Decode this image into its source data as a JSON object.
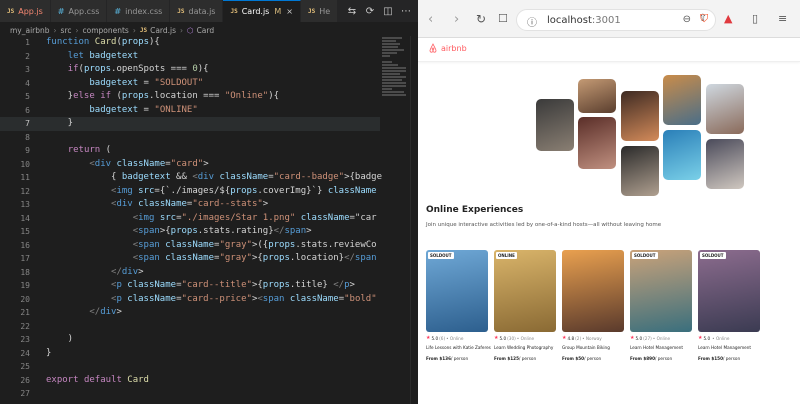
{
  "editor": {
    "tabs": [
      {
        "name": "App.js",
        "type": "js",
        "active": false,
        "color": "red"
      },
      {
        "name": "App.css",
        "type": "css",
        "active": false
      },
      {
        "name": "index.css",
        "type": "css",
        "active": false
      },
      {
        "name": "data.js",
        "type": "js",
        "active": false
      },
      {
        "name": "Card.js",
        "type": "js",
        "active": true,
        "modified": "M"
      },
      {
        "name": "He",
        "type": "js",
        "active": false
      }
    ],
    "breadcrumb": [
      "my_airbnb",
      "src",
      "components",
      "Card.js",
      "Card"
    ],
    "code": [
      "function Card(props){",
      "    let badgetext",
      "    if(props.openSpots === 0){",
      "        badgetext = \"SOLDOUT\"",
      "    }else if (props.location === \"Online\"){",
      "        badgetext = \"ONLINE\"",
      "    }",
      "",
      "    return (",
      "        <div className=\"card\">",
      "            { badgetext && <div className=\"card--badge\">{badge",
      "            <img src={`./images/${props.coverImg}`} className",
      "            <div className=\"card--stats\">",
      "                <img src=\"./images/Star 1.png\" className=\"car",
      "                <span>{props.stats.rating}</span>",
      "                <span className=\"gray\">({props.stats.reviewCo",
      "                <span className=\"gray\">{props.location}</span",
      "            </div>",
      "            <p className=\"card--title\">{props.title} </p>",
      "            <p className=\"card--price\"><span className=\"bold\"",
      "        </div>",
      "",
      "    )",
      "}",
      "",
      "export default Card",
      ""
    ]
  },
  "browser": {
    "url_host": "localhost",
    "url_port": ":3001",
    "logo_text": "airbnb",
    "section_title": "Online Experiences",
    "section_desc": "Join unique interactive activities led by one-of-a-kind hosts—all without leaving home",
    "cards": [
      {
        "badge": "SOLDOUT",
        "rating": "5.0",
        "reviews": "(6)",
        "location": "• Online",
        "title": "Life Lessons with Katie Zaferes",
        "price": "From $136",
        "per": "/ person",
        "colors": [
          "#6fa8d6",
          "#2d5f8e"
        ]
      },
      {
        "badge": "ONLINE",
        "rating": "5.0",
        "reviews": "(30)",
        "location": "• Online",
        "title": "Learn Wedding Photography",
        "price": "From $125",
        "per": "/ person",
        "colors": [
          "#d9b46a",
          "#8a6a34"
        ]
      },
      {
        "badge": "",
        "rating": "4.8",
        "reviews": "(2)",
        "location": "• Norway",
        "title": "Group Mountain Biking",
        "price": "From $50",
        "per": "/ person",
        "colors": [
          "#e9a04f",
          "#5a3a2c"
        ]
      },
      {
        "badge": "SOLDOUT",
        "rating": "5.0",
        "reviews": "(27)",
        "location": "• Online",
        "title": "Learn Hotel Management",
        "price": "From $890",
        "per": "/ person",
        "colors": [
          "#c9a27a",
          "#3a6f7d"
        ]
      },
      {
        "badge": "SOLDOUT",
        "rating": "5.0",
        "reviews": "",
        "location": "• Online",
        "title": "Learn Hotel Management",
        "price": "From $150",
        "per": "/ person",
        "colors": [
          "#8c6c8e",
          "#3b3b52"
        ]
      }
    ],
    "hero_images": [
      {
        "colors": [
          "#3a3a3a",
          "#8a7f73"
        ]
      },
      {
        "colors": [
          "#c49a74",
          "#5a3e2e"
        ]
      },
      {
        "colors": [
          "#5a2e28",
          "#c09080"
        ]
      },
      {
        "colors": [
          "#3e2a22",
          "#d48b5a"
        ]
      },
      {
        "colors": [
          "#c98c4a",
          "#4a6e88"
        ]
      },
      {
        "colors": [
          "#2a2a2a",
          "#b0a090"
        ]
      },
      {
        "colors": [
          "#2a7fb8",
          "#7ad0e8"
        ]
      },
      {
        "colors": [
          "#cfd8e0",
          "#8a6a5a"
        ]
      },
      {
        "colors": [
          "#4a4a5a",
          "#d0c8c0"
        ]
      }
    ],
    "accent": "#ff5a5f"
  }
}
